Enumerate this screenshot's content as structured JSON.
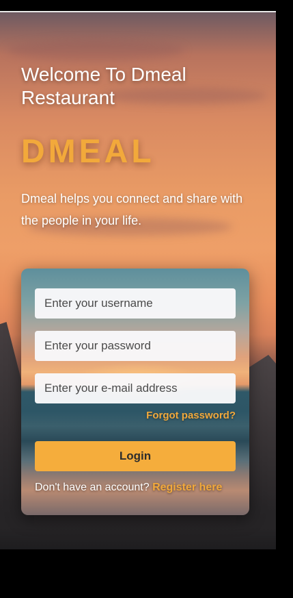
{
  "header": {
    "welcome_line_1": "Welcome To Dmeal",
    "welcome_line_2": "Restaurant",
    "brand": "DMEAL",
    "tagline": "Dmeal helps you connect and share with the people in your life."
  },
  "form": {
    "username_placeholder": "Enter your username",
    "password_placeholder": "Enter your password",
    "email_placeholder": "Enter your e-mail address",
    "forgot_password": "Forgot password?",
    "login_label": "Login",
    "no_account_text": "Don't have an account?",
    "register_link": "Register here"
  },
  "colors": {
    "accent": "#f5ad3c",
    "link": "#f2a93b",
    "text_light": "#ffffff"
  }
}
